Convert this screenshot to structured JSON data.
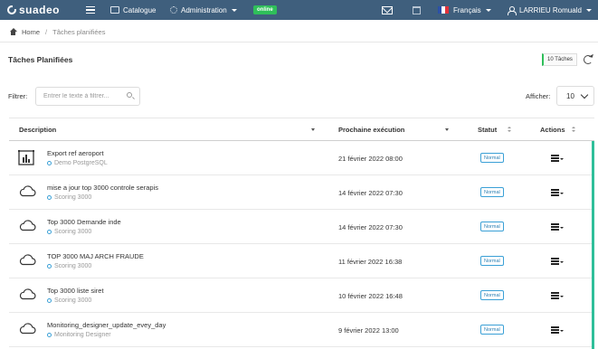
{
  "topbar": {
    "logo_text": "suadeo",
    "catalogue": "Catalogue",
    "administration": "Administration",
    "online": "online",
    "language": "Français",
    "user": "LARRIEU Romuald",
    "colors": {
      "bar": "#3f5f7d",
      "online": "#2fbf5a"
    }
  },
  "breadcrumb": {
    "home": "Home",
    "sep": "/",
    "current": "Tâches planifiées"
  },
  "page": {
    "title": "Tâches Planifiées",
    "count_badge": "10 Tâches"
  },
  "filter": {
    "label": "Filtrer:",
    "placeholder": "Entrer le texte à filtrer...",
    "value": ""
  },
  "show": {
    "label": "Afficher:",
    "value": "10"
  },
  "table": {
    "headers": {
      "description": "Description",
      "next_run": "Prochaine exécution",
      "status": "Statut",
      "actions": "Actions"
    },
    "rows": [
      {
        "icon": "chart-icon",
        "name": "Export ref aeroport",
        "source": "Demo PostgreSQL",
        "next_run": "21 février 2022 08:00",
        "status": "Normal"
      },
      {
        "icon": "cloud-icon",
        "name": "mise a jour top 3000 controle serapis",
        "source": "Scoring 3000",
        "next_run": "14 février 2022 07:30",
        "status": "Normal"
      },
      {
        "icon": "cloud-icon",
        "name": "Top 3000 Demande inde",
        "source": "Scoring 3000",
        "next_run": "14 février 2022 07:30",
        "status": "Normal"
      },
      {
        "icon": "cloud-icon",
        "name": "TOP 3000 MAJ ARCH FRAUDE",
        "source": "Scoring 3000",
        "next_run": "11 février 2022 16:38",
        "status": "Normal"
      },
      {
        "icon": "cloud-icon",
        "name": "Top 3000 liste siret",
        "source": "Scoring 3000",
        "next_run": "10 février 2022 16:48",
        "status": "Normal"
      },
      {
        "icon": "cloud-icon",
        "name": "Monitoring_designer_update_evey_day",
        "source": "Monitoring Designer",
        "next_run": "9 février 2022 13:00",
        "status": "Normal"
      }
    ]
  }
}
